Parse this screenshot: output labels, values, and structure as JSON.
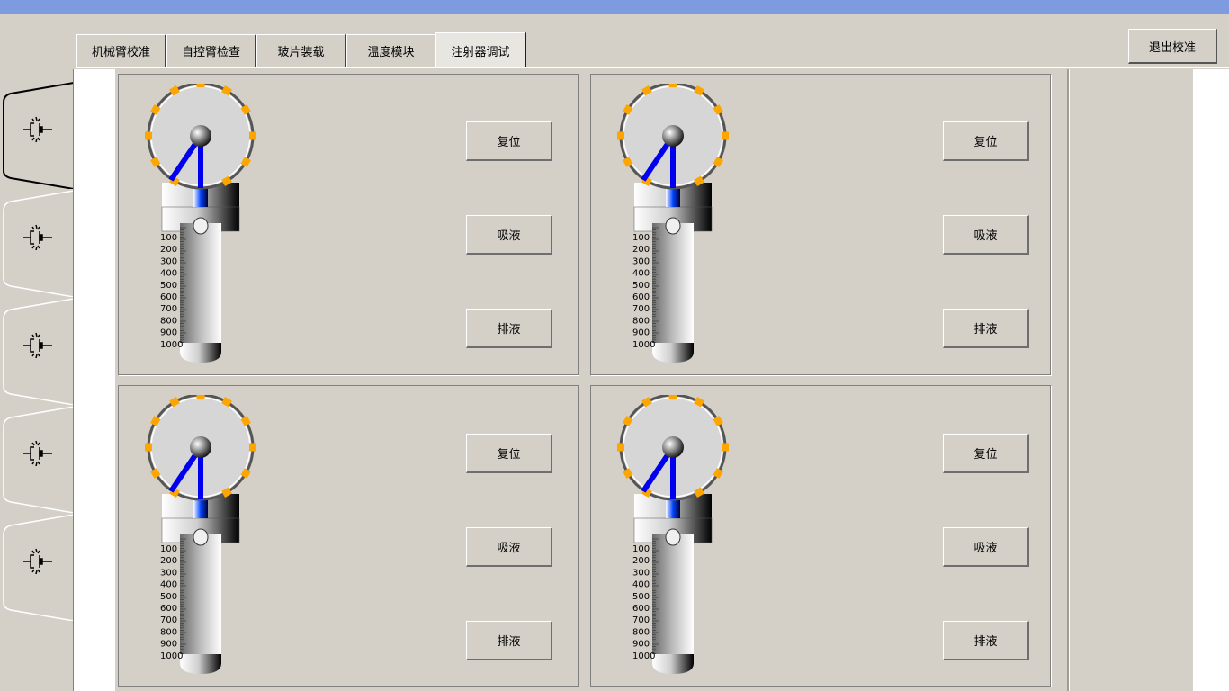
{
  "tabs": [
    {
      "label": "机械臂校准"
    },
    {
      "label": "自控臂检查"
    },
    {
      "label": "玻片装载"
    },
    {
      "label": "温度模块"
    },
    {
      "label": "注射器调试"
    }
  ],
  "active_tab": "注射器调试",
  "exit_button": {
    "label": "退出校准"
  },
  "side_tabs": [
    {
      "icon": "plug-connector-icon"
    },
    {
      "icon": "plug-connector-icon"
    },
    {
      "icon": "plug-connector-icon"
    },
    {
      "icon": "plug-connector-icon"
    },
    {
      "icon": "plug-connector-icon"
    }
  ],
  "panels": [
    {
      "reset_label": "复位",
      "aspirate_label": "吸液",
      "dispense_label": "排液"
    },
    {
      "reset_label": "复位",
      "aspirate_label": "吸液",
      "dispense_label": "排液"
    },
    {
      "reset_label": "复位",
      "aspirate_label": "吸液",
      "dispense_label": "排液"
    },
    {
      "reset_label": "复位",
      "aspirate_label": "吸液",
      "dispense_label": "排液"
    }
  ],
  "scale_labels": [
    "100",
    "200",
    "300",
    "400",
    "500",
    "600",
    "700",
    "800",
    "900",
    "1000"
  ],
  "colors": {
    "background": "#d4d0c8",
    "titlebar": "#7f9be0",
    "valve_port": "#ffa500",
    "valve_needle": "#0000ee"
  }
}
